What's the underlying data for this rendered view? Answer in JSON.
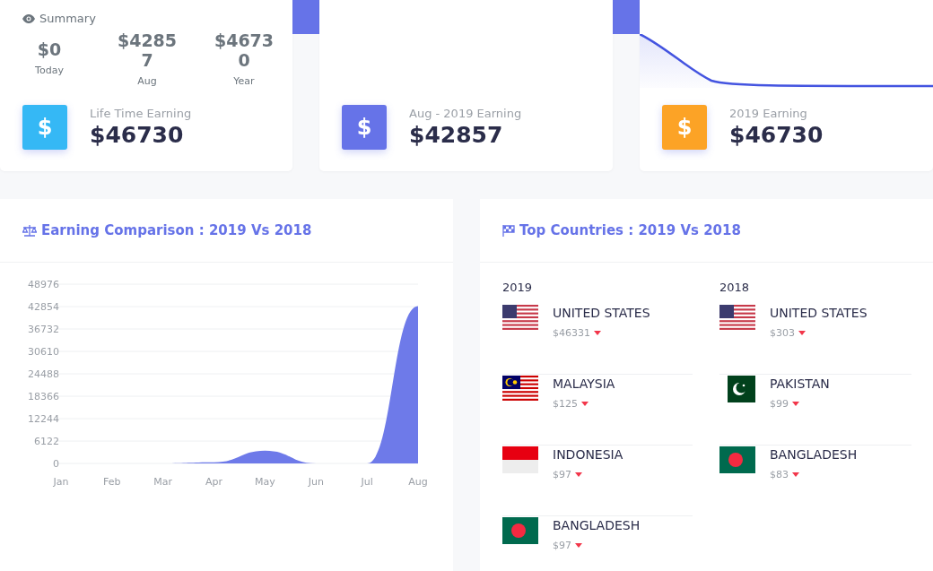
{
  "summary_card": {
    "title": "Summary",
    "stats": [
      {
        "value": "$0",
        "label": "Today"
      },
      {
        "value": "$42857",
        "label": "Aug"
      },
      {
        "value": "$46730",
        "label": "Year"
      }
    ],
    "earning": {
      "label": "Life Time Earning",
      "value": "$46730",
      "color": "#35b8f5",
      "symbol": "$"
    }
  },
  "earning_cards": [
    {
      "label": "Aug - 2019 Earning",
      "value": "$42857",
      "color": "#6673e8",
      "symbol": "$",
      "sparkline": false
    },
    {
      "label": "2019 Earning",
      "value": "$46730",
      "color": "#fca326",
      "symbol": "$",
      "sparkline": true
    }
  ],
  "comparison": {
    "title": "Earning Comparison : 2019 Vs 2018",
    "chart_data": {
      "type": "area",
      "categories": [
        "Jan",
        "Feb",
        "Mar",
        "Apr",
        "May",
        "Jun",
        "Jul",
        "Aug"
      ],
      "grid": true,
      "series": [
        {
          "color": "#6673e8",
          "values": [
            0,
            0,
            0,
            300,
            3500,
            0,
            0,
            43000
          ]
        }
      ],
      "ylim": [
        0,
        48976
      ],
      "yticks": [
        0,
        6122,
        12244,
        18366,
        24488,
        30610,
        36732,
        42854,
        48976
      ]
    }
  },
  "top_countries": {
    "title": "Top Countries : 2019 Vs 2018",
    "columns": [
      {
        "year": "2019",
        "items": [
          {
            "name": "UNITED STATES",
            "amount": "$46331",
            "kind": "us"
          },
          {
            "name": "MALAYSIA",
            "amount": "$125",
            "kind": "my"
          },
          {
            "name": "INDONESIA",
            "amount": "$97",
            "kind": "id"
          },
          {
            "name": "BANGLADESH",
            "amount": "$97",
            "kind": "bd"
          }
        ]
      },
      {
        "year": "2018",
        "items": [
          {
            "name": "UNITED STATES",
            "amount": "$303",
            "kind": "us"
          },
          {
            "name": "PAKISTAN",
            "amount": "$99",
            "kind": "pk"
          },
          {
            "name": "BANGLADESH",
            "amount": "$83",
            "kind": "bd"
          }
        ]
      }
    ]
  }
}
